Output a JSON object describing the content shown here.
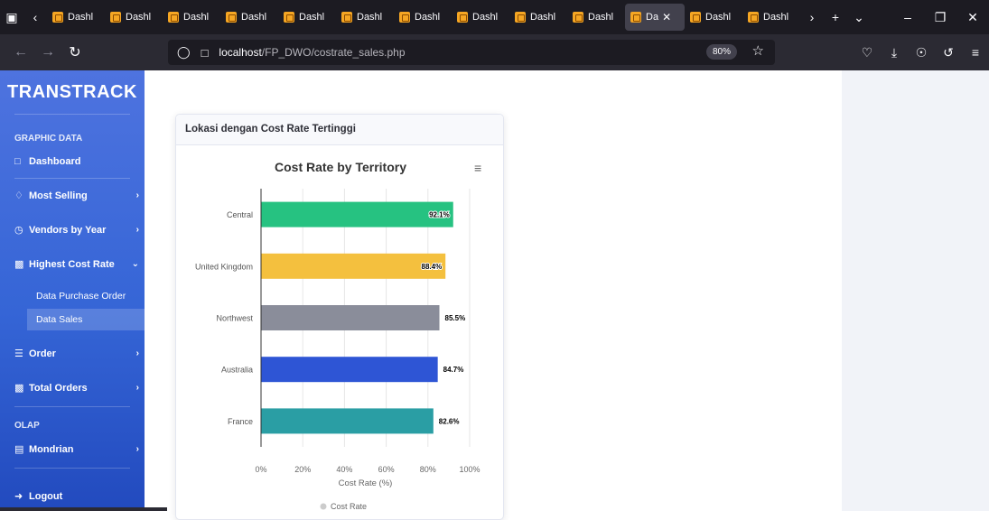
{
  "browser": {
    "tabs": [
      {
        "label": "Dashl"
      },
      {
        "label": "Dashl"
      },
      {
        "label": "Dashl"
      },
      {
        "label": "Dashl"
      },
      {
        "label": "Dashl"
      },
      {
        "label": "Dashl"
      },
      {
        "label": "Dashl"
      },
      {
        "label": "Dashl"
      },
      {
        "label": "Dashl"
      },
      {
        "label": "Dashl"
      },
      {
        "label": "Da",
        "active": true
      },
      {
        "label": "Dashl"
      },
      {
        "label": "Dashl"
      }
    ],
    "url_host": "localhost",
    "url_path": "/FP_DWO/costrate_sales.php",
    "zoom": "80%"
  },
  "sidebar": {
    "brand": "TRANSTRACK",
    "heading_graphic": "GRAPHIC DATA",
    "items": {
      "dashboard": "Dashboard",
      "most_selling": "Most Selling",
      "vendors_by_year": "Vendors by Year",
      "highest_cost_rate": "Highest Cost Rate",
      "data_purchase_order": "Data Purchase Order",
      "data_sales": "Data Sales",
      "order": "Order",
      "total_orders": "Total Orders",
      "mondrian": "Mondrian",
      "logout": "Logout"
    },
    "heading_olap": "OLAP"
  },
  "card": {
    "header": "Lokasi dengan Cost Rate Tertinggi"
  },
  "chart_data": {
    "type": "bar",
    "orientation": "horizontal",
    "title": "Cost Rate by Territory",
    "categories": [
      "Central",
      "United Kingdom",
      "Northwest",
      "Australia",
      "France"
    ],
    "series": [
      {
        "name": "Cost Rate",
        "values": [
          92.1,
          88.4,
          85.5,
          84.7,
          82.6
        ],
        "labels": [
          "92.1%",
          "88.4%",
          "85.5%",
          "84.7%",
          "82.6%"
        ],
        "colors": [
          "#26c281",
          "#f4c03e",
          "#8a8d9a",
          "#2e55d5",
          "#2a9ea4"
        ]
      }
    ],
    "xlabel": "Cost Rate (%)",
    "xlim": [
      0,
      100
    ],
    "xticks": [
      "0%",
      "20%",
      "40%",
      "60%",
      "80%",
      "100%"
    ],
    "grid": true,
    "legend_position": "bottom"
  }
}
